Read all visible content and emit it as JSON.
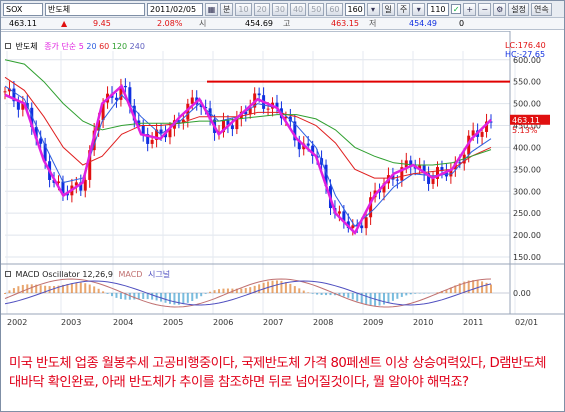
{
  "toolbar": {
    "symbol": "SOX",
    "name": "반도체",
    "date": "2011/02/05",
    "period_unit": "분",
    "minute_buttons": [
      "10",
      "20",
      "30",
      "40",
      "50",
      "60"
    ],
    "count_value": "160",
    "day_button": "일",
    "week_button": "주",
    "bar_count": "110",
    "settings_button": "설정",
    "chain_button": "연속"
  },
  "quote": {
    "price": "463.11",
    "change": "9.45",
    "change_pct": "2.08%",
    "open_label": "시",
    "open": "454.69",
    "high_label": "고",
    "high": "463.15",
    "low_label": "저",
    "low": "454.49",
    "volume": "0"
  },
  "price_panel": {
    "name": "반도체",
    "ma_label": "종가 단순",
    "ma_periods": [
      "5",
      "20",
      "60",
      "120",
      "240"
    ],
    "ma_colors": [
      "#e020e0",
      "#3060e0",
      "#e02020",
      "#30a030",
      "#6060c0"
    ],
    "lc_label": "LC:176.40",
    "hc_label": "HC:-27.65",
    "last_price": "463.11",
    "last_pct": "5.13%",
    "y_ticks": [
      "600.00",
      "550.00",
      "500.00",
      "450.00",
      "400.00",
      "350.00",
      "300.00",
      "250.00",
      "200.00",
      "150.00"
    ],
    "resistance": 550
  },
  "macd_panel": {
    "label": "MACD Oscillator 12,26,9",
    "macd_label": "MACD",
    "signal_label": "시그널",
    "zero_label": "0.00",
    "colors": {
      "oscillator": "#e08030",
      "macd": "#c07070",
      "signal": "#5050c0"
    }
  },
  "x_ticks": [
    "2002",
    "2003",
    "2004",
    "2005",
    "2006",
    "2007",
    "2008",
    "2009",
    "2010",
    "2011",
    "02/01"
  ],
  "chart_data": {
    "type": "line",
    "title": "반도체",
    "x": [
      "2002-01",
      "2002-07",
      "2003-01",
      "2003-04",
      "2003-07",
      "2004-01",
      "2004-04",
      "2004-07",
      "2005-01",
      "2005-07",
      "2006-01",
      "2006-07",
      "2007-01",
      "2007-07",
      "2007-10",
      "2008-01",
      "2008-07",
      "2008-11",
      "2009-03",
      "2009-07",
      "2010-01",
      "2010-04",
      "2010-07",
      "2010-10",
      "2011-01",
      "2011-02"
    ],
    "series": [
      {
        "name": "5",
        "values": [
          520,
          500,
          370,
          290,
          320,
          500,
          540,
          430,
          420,
          470,
          510,
          430,
          470,
          510,
          490,
          420,
          380,
          250,
          205,
          290,
          340,
          360,
          330,
          350,
          420,
          463
        ]
      },
      {
        "name": "20",
        "values": [
          540,
          510,
          410,
          320,
          330,
          460,
          520,
          470,
          430,
          460,
          500,
          460,
          470,
          500,
          490,
          450,
          400,
          290,
          220,
          260,
          310,
          340,
          335,
          340,
          390,
          420
        ]
      }
    ],
    "ylim": [
      150,
      620
    ]
  }
}
